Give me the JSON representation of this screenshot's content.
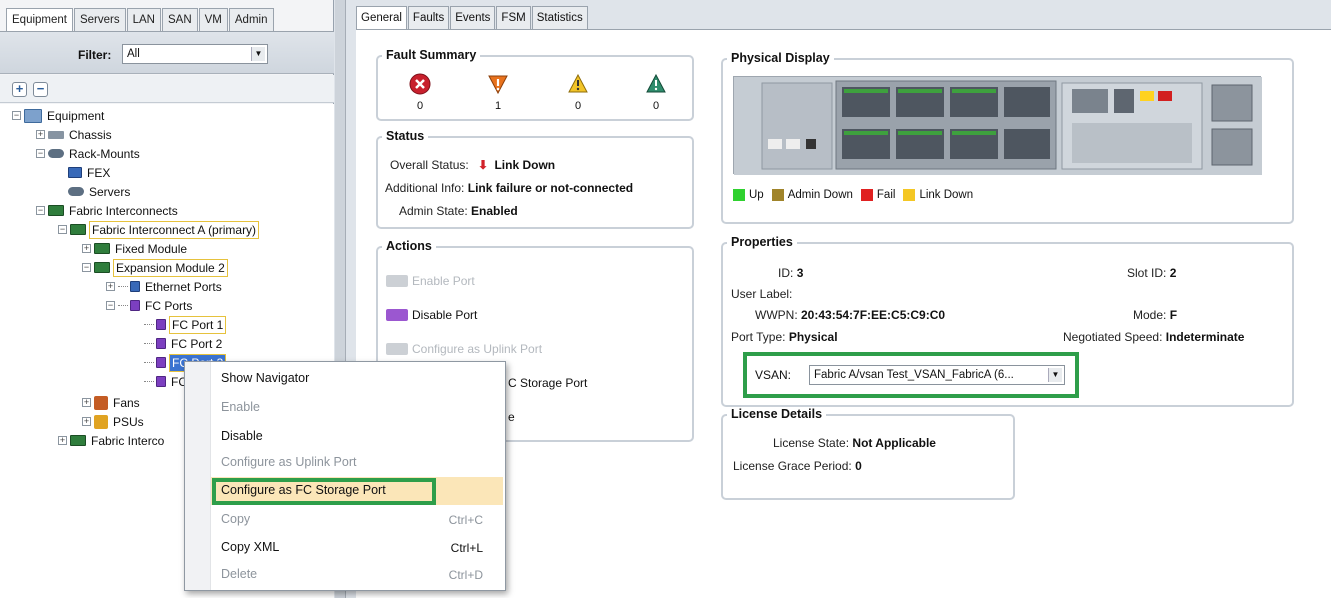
{
  "left": {
    "tabs": [
      "Equipment",
      "Servers",
      "LAN",
      "SAN",
      "VM",
      "Admin"
    ],
    "filter_label": "Filter:",
    "filter_value": "All",
    "tree": {
      "equipment": "Equipment",
      "chassis": "Chassis",
      "rack_mounts": "Rack-Mounts",
      "fex": "FEX",
      "servers": "Servers",
      "fabric_interconnects": "Fabric Interconnects",
      "fi_a": "Fabric Interconnect A (primary)",
      "fixed_module": "Fixed Module",
      "expansion_module": "Expansion Module 2",
      "ethernet_ports": "Ethernet Ports",
      "fc_ports": "FC Ports",
      "fc_port_1": "FC Port 1",
      "fc_port_2": "FC Port 2",
      "fc_port_3": "FC Port 3",
      "fc_port_4": "FC",
      "fans": "Fans",
      "psus": "PSUs",
      "fi_b": "Fabric Interco"
    }
  },
  "main": {
    "tabs": [
      "General",
      "Faults",
      "Events",
      "FSM",
      "Statistics"
    ],
    "fault_summary": {
      "title": "Fault Summary",
      "counts": [
        "0",
        "1",
        "0",
        "0"
      ]
    },
    "status": {
      "title": "Status",
      "overall_label": "Overall Status:",
      "overall_value": "Link Down",
      "info_label": "Additional Info:",
      "info_value": "Link failure or not-connected",
      "admin_label": "Admin State:",
      "admin_value": "Enabled"
    },
    "actions": {
      "title": "Actions",
      "enable": "Enable Port",
      "disable": "Disable Port",
      "uplink": "Configure as Uplink Port",
      "storage_partial": "C Storage Port",
      "unconfig_partial": "e"
    },
    "physical_display": {
      "title": "Physical Display",
      "legend": [
        "Up",
        "Admin Down",
        "Fail",
        "Link Down"
      ]
    },
    "properties": {
      "title": "Properties",
      "id_label": "ID:",
      "id_value": "3",
      "slot_label": "Slot ID:",
      "slot_value": "2",
      "user_label_label": "User Label:",
      "user_label_value": "",
      "wwpn_label": "WWPN:",
      "wwpn_value": "20:43:54:7F:EE:C5:C9:C0",
      "mode_label": "Mode:",
      "mode_value": "F",
      "port_type_label": "Port Type:",
      "port_type_value": "Physical",
      "speed_label": "Negotiated Speed:",
      "speed_value": "Indeterminate",
      "vsan_label": "VSAN:",
      "vsan_value": "Fabric A/vsan Test_VSAN_FabricA (6..."
    },
    "license": {
      "title": "License Details",
      "state_label": "License State:",
      "state_value": "Not Applicable",
      "grace_label": "License Grace Period:",
      "grace_value": "0"
    }
  },
  "context_menu": {
    "items": [
      {
        "label": "Show Navigator",
        "shortcut": "",
        "enabled": true
      },
      {
        "label": "Enable",
        "shortcut": "",
        "enabled": false
      },
      {
        "label": "Disable",
        "shortcut": "",
        "enabled": true
      },
      {
        "label": "Configure as Uplink Port",
        "shortcut": "",
        "enabled": false
      },
      {
        "label": "Configure as FC Storage Port",
        "shortcut": "",
        "enabled": true
      },
      {
        "label": "Copy",
        "shortcut": "Ctrl+C",
        "enabled": false
      },
      {
        "label": "Copy XML",
        "shortcut": "Ctrl+L",
        "enabled": true
      },
      {
        "label": "Delete",
        "shortcut": "Ctrl+D",
        "enabled": false
      }
    ]
  },
  "colors": {
    "highlight_green": "#2e9e4a",
    "selection_blue": "#3b73d1",
    "legend_up": "#2fd12f",
    "legend_admin_down": "#a0842a",
    "legend_fail": "#e02121",
    "legend_link_down": "#f4c724"
  }
}
